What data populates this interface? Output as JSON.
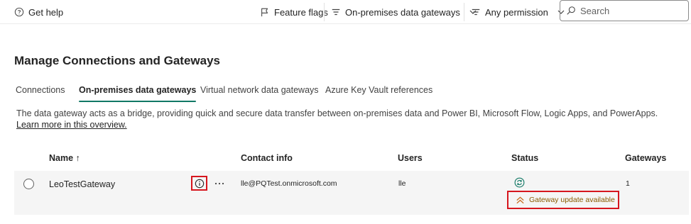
{
  "toolbar": {
    "get_help": "Get help",
    "feature_flags": "Feature flags",
    "gateway_filter": "On-premises data gateways",
    "permission_filter": "Any permission",
    "search_placeholder": "Search"
  },
  "page": {
    "title": "Manage Connections and Gateways"
  },
  "tabs": [
    {
      "label": "Connections",
      "active": false
    },
    {
      "label": "On-premises data gateways",
      "active": true
    },
    {
      "label": "Virtual network data gateways",
      "active": false
    },
    {
      "label": "Azure Key Vault references",
      "active": false
    }
  ],
  "description": {
    "text": "The data gateway acts as a bridge, providing quick and secure data transfer between on-premises data and Power BI, Microsoft Flow, Logic Apps, and PowerApps. ",
    "link": "Learn more in this overview."
  },
  "table": {
    "columns": {
      "name": "Name ↑",
      "contact": "Contact info",
      "users": "Users",
      "status": "Status",
      "gateways": "Gateways"
    },
    "rows": [
      {
        "name": "LeoTestGateway",
        "contact": "lle@PQTest.onmicrosoft.com",
        "users": "lle",
        "status_update": "Gateway update available",
        "gateways": "1"
      }
    ]
  },
  "colors": {
    "accent_tab": "#117865",
    "highlight_box": "#d6161e",
    "update_icon": "#c8691c"
  },
  "icons": {
    "help": "question-circle-icon",
    "feature_flags": "flag-icon",
    "filter": "filter-lines-icon",
    "search": "search-icon",
    "info": "info-icon",
    "more": "ellipsis-icon",
    "status": "sync-icon",
    "update": "double-chevron-up-icon"
  }
}
